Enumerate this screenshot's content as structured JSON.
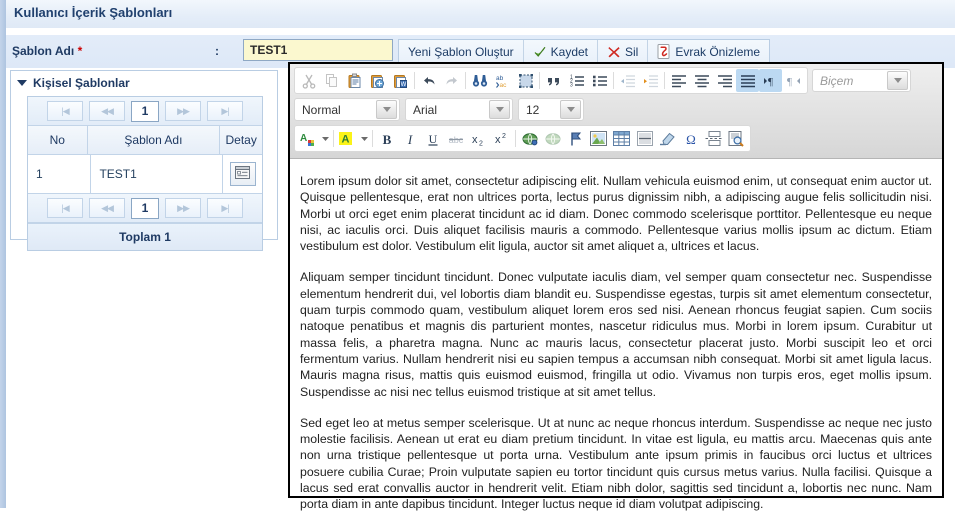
{
  "header": {
    "title": "Kullanıcı İçerik Şablonları"
  },
  "form": {
    "label": "Şablon Adı",
    "required_mark": "*",
    "colon": ":",
    "template_name_value": "TEST1",
    "buttons": [
      {
        "label": "Yeni Şablon Oluştur",
        "icon": "none"
      },
      {
        "label": "Kaydet",
        "icon": "green-check-icon"
      },
      {
        "label": "Sil",
        "icon": "red-x-icon"
      },
      {
        "label": "Evrak Önizleme",
        "icon": "pdf-icon"
      }
    ]
  },
  "panel": {
    "title": "Kişisel Şablonlar",
    "pager": {
      "first": "|◀",
      "prev": "◀◀",
      "page": "1",
      "next": "▶▶",
      "last": "▶|"
    },
    "columns": [
      "No",
      "Şablon Adı",
      "Detay"
    ],
    "rows": [
      {
        "no": "1",
        "name": "TEST1",
        "detail_icon": "detail-window-icon"
      }
    ],
    "total": "Toplam 1"
  },
  "editor": {
    "toolbar_row1": [
      "cut-icon",
      "copy-icon",
      "paste-icon",
      "paste-text-icon",
      "paste-word-icon",
      "undo-icon",
      "redo-icon",
      "find-icon",
      "replace-icon",
      "select-all-icon",
      "blockquote-icon",
      "numbered-list-icon",
      "bulleted-list-icon",
      "outdent-icon",
      "indent-icon",
      "align-left-icon",
      "align-center-icon",
      "align-right-icon",
      "align-justify-icon",
      "ltr-icon",
      "rtl-icon"
    ],
    "format_select": {
      "value": "Normal"
    },
    "font_select": {
      "value": "Arial"
    },
    "size_select": {
      "value": "12"
    },
    "style_select": {
      "placeholder": "Biçem"
    },
    "toolbar_row3": [
      "text-color-icon",
      "background-color-icon",
      "bold-icon",
      "italic-icon",
      "underline-icon",
      "strikethrough-icon",
      "subscript-icon",
      "superscript-icon",
      "link-icon",
      "unlink-icon",
      "anchor-icon",
      "image-icon",
      "table-icon",
      "horizontal-rule-icon",
      "remove-format-icon",
      "special-char-icon",
      "page-break-icon",
      "source-preview-icon"
    ],
    "content": [
      "Lorem ipsum dolor sit amet, consectetur adipiscing elit. Nullam vehicula euismod enim, ut consequat enim auctor ut. Quisque pellentesque, erat non ultrices porta, lectus purus dignissim nibh, a adipiscing augue felis sollicitudin nisi. Morbi ut orci eget enim placerat tincidunt ac id diam. Donec commodo scelerisque porttitor. Pellentesque eu neque nisi, ac iaculis orci. Duis aliquet facilisis mauris a commodo. Pellentesque varius mollis ipsum ac dictum. Etiam vestibulum est dolor. Vestibulum elit ligula, auctor sit amet aliquet a, ultrices et lacus.",
      "Aliquam semper tincidunt tincidunt. Donec vulputate iaculis diam, vel semper quam consectetur nec. Suspendisse elementum hendrerit dui, vel lobortis diam blandit eu. Suspendisse egestas, turpis sit amet elementum consectetur, quam turpis commodo quam, vestibulum aliquet lorem eros sed nisi. Aenean rhoncus feugiat sapien. Cum sociis natoque penatibus et magnis dis parturient montes, nascetur ridiculus mus. Morbi in lorem ipsum. Curabitur ut massa felis, a pharetra magna. Nunc ac mauris lacus, consectetur placerat justo. Morbi suscipit leo et orci fermentum varius. Nullam hendrerit nisi eu sapien tempus a accumsan nibh consequat. Morbi sit amet ligula lacus. Mauris magna risus, mattis quis euismod euismod, fringilla ut odio. Vivamus non turpis eros, eget mollis ipsum. Suspendisse ac nisi nec tellus euismod tristique at sit amet tellus.",
      "Sed eget leo at metus semper scelerisque. Ut at nunc ac neque rhoncus interdum. Suspendisse ac neque nec justo molestie facilisis. Aenean ut erat eu diam pretium tincidunt. In vitae est ligula, eu mattis arcu. Maecenas quis ante non urna tristique pellentesque ut porta urna. Vestibulum ante ipsum primis in faucibus orci luctus et ultrices posuere cubilia Curae; Proin vulputate sapien eu tortor tincidunt quis cursus metus varius. Nulla facilisi. Quisque a lacus sed erat convallis auctor in hendrerit velit. Etiam nibh dolor, sagittis sed tincidunt a, lobortis nec nunc. Nam porta diam in ante dapibus tincidunt. Integer luctus neque id diam volutpat adipiscing."
    ]
  },
  "colors": {
    "accent": "#1f3a63",
    "field_bg": "#fbf8cf",
    "required": "#cc0000",
    "toolbar_active": "#bcd9f2"
  }
}
